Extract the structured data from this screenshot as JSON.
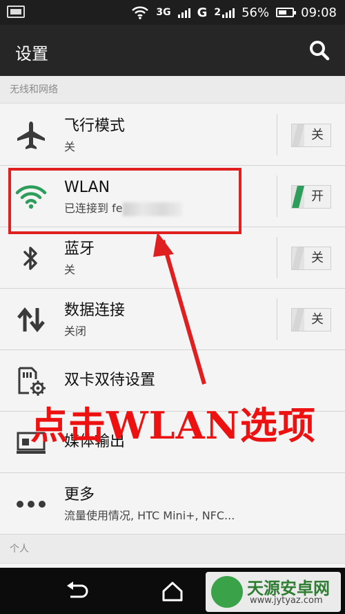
{
  "status_bar": {
    "network_3g": "3G",
    "network_g": "G",
    "sim2": "2",
    "battery": "56%",
    "time": "09:08"
  },
  "action_bar": {
    "title": "设置",
    "search_icon": "search-icon"
  },
  "sections": {
    "wireless": "无线和网络",
    "personal": "个人"
  },
  "rows": [
    {
      "label": "飞行模式",
      "sub": "关",
      "icon": "airplane-icon",
      "toggle": "关"
    },
    {
      "label": "WLAN",
      "sub": "已连接到 fe",
      "icon": "wifi-icon",
      "toggle": "开"
    },
    {
      "label": "蓝牙",
      "sub": "关",
      "icon": "bluetooth-icon",
      "toggle": "关"
    },
    {
      "label": "数据连接",
      "sub": "关闭",
      "icon": "data-transfer-icon",
      "toggle": "关"
    },
    {
      "label": "双卡双待设置",
      "icon": "dual-sim-icon"
    },
    {
      "label": "媒体输出",
      "icon": "media-output-icon"
    },
    {
      "label": "更多",
      "sub": "流量使用情况, HTC Mini+, NFC...",
      "icon": "more-icon"
    }
  ],
  "annotation": "点击WLAN选项",
  "watermark": {
    "title": "天源安卓网",
    "url": "www.jytyaz.com"
  },
  "colors": {
    "accent_green": "#2e9d5b",
    "annotation_red": "#e02020",
    "action_bar": "#262626"
  }
}
